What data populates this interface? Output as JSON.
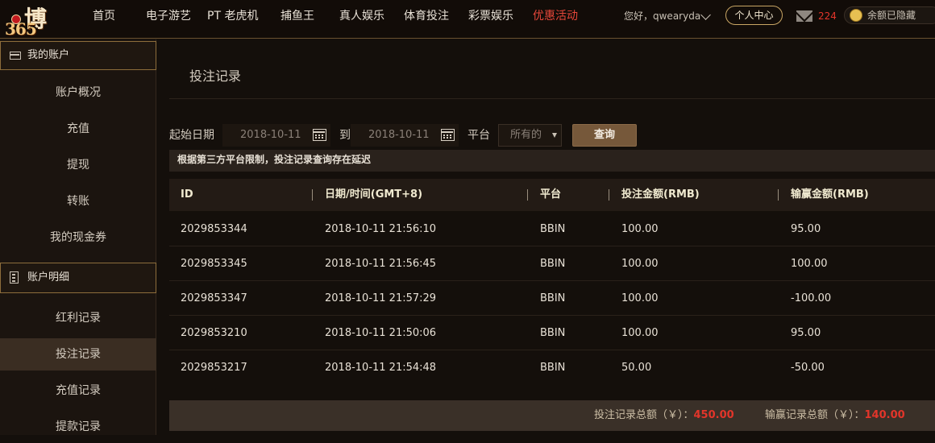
{
  "header": {
    "nav": [
      {
        "label": "首页",
        "active": false
      },
      {
        "label": "电子游艺",
        "active": false
      },
      {
        "label": "PT 老虎机",
        "active": false
      },
      {
        "label": "捕鱼王",
        "active": false
      },
      {
        "label": "真人娱乐",
        "active": false
      },
      {
        "label": "体育投注",
        "active": false
      },
      {
        "label": "彩票娱乐",
        "active": false
      },
      {
        "label": "优惠活动",
        "active": true
      }
    ],
    "greeting": "您好，qwearyda",
    "user_center": "个人中心",
    "mail_count": "224",
    "balance_text": "余额已隐藏"
  },
  "sidebar": {
    "section1_title": "我的账户",
    "section1_items": [
      "账户概况",
      "充值",
      "提现",
      "转账",
      "我的现金券"
    ],
    "section2_title": "账户明细",
    "section2_items": [
      "红利记录",
      "投注记录",
      "充值记录",
      "提款记录"
    ],
    "active_item": "投注记录"
  },
  "main": {
    "title": "投注记录",
    "filters": {
      "start_label": "起始日期",
      "start_value": "2018-10-11",
      "to_label": "到",
      "end_value": "2018-10-11",
      "platform_label": "平台",
      "platform_value": "所有的",
      "query_button": "查询"
    },
    "notice": "根据第三方平台限制，投注记录查询存在延迟",
    "table": {
      "headers": [
        "ID",
        "日期/时间(GMT+8)",
        "平台",
        "投注金额(RMB)",
        "输赢金额(RMB)"
      ],
      "rows": [
        [
          "2029853344",
          "2018-10-11 21:56:10",
          "BBIN",
          "100.00",
          "95.00"
        ],
        [
          "2029853345",
          "2018-10-11 21:56:45",
          "BBIN",
          "100.00",
          "100.00"
        ],
        [
          "2029853347",
          "2018-10-11 21:57:29",
          "BBIN",
          "100.00",
          "-100.00"
        ],
        [
          "2029853210",
          "2018-10-11 21:50:06",
          "BBIN",
          "100.00",
          "95.00"
        ],
        [
          "2029853217",
          "2018-10-11 21:54:48",
          "BBIN",
          "50.00",
          "-50.00"
        ]
      ]
    },
    "footer": {
      "bet_total_label": "投注记录总额（￥）：",
      "bet_total_value": "450.00",
      "win_total_label": "输赢记录总额（￥）：",
      "win_total_value": "140.00"
    }
  },
  "colors": {
    "accent_red": "#e2352a",
    "gold_border": "#8d6d3b",
    "button_brown": "#76583a"
  }
}
